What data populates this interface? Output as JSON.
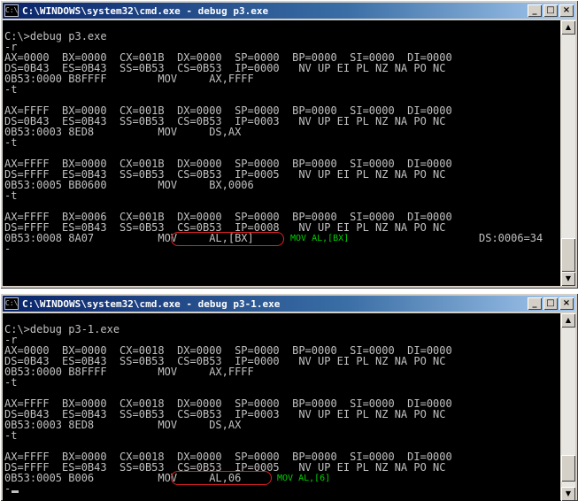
{
  "window1": {
    "title": "C:\\WINDOWS\\system32\\cmd.exe - debug p3.exe",
    "icon_text": "C:\\",
    "lines": [
      "",
      "C:\\>debug p3.exe",
      "-r",
      "AX=0000  BX=0000  CX=001B  DX=0000  SP=0000  BP=0000  SI=0000  DI=0000",
      "DS=0B43  ES=0B43  SS=0B53  CS=0B53  IP=0000   NV UP EI PL NZ NA PO NC",
      "0B53:0000 B8FFFF        MOV     AX,FFFF",
      "-t",
      "",
      "AX=FFFF  BX=0000  CX=001B  DX=0000  SP=0000  BP=0000  SI=0000  DI=0000",
      "DS=0B43  ES=0B43  SS=0B53  CS=0B53  IP=0003   NV UP EI PL NZ NA PO NC",
      "0B53:0003 8ED8          MOV     DS,AX",
      "-t",
      "",
      "AX=FFFF  BX=0000  CX=001B  DX=0000  SP=0000  BP=0000  SI=0000  DI=0000",
      "DS=FFFF  ES=0B43  SS=0B53  CS=0B53  IP=0005   NV UP EI PL NZ NA PO NC",
      "0B53:0005 BB0600        MOV     BX,0006",
      "-t",
      "",
      "AX=FFFF  BX=0006  CX=001B  DX=0000  SP=0000  BP=0000  SI=0000  DI=0000",
      "DS=FFFF  ES=0B43  SS=0B53  CS=0B53  IP=0008   NV UP EI PL NZ NA PO NC",
      "0B53:0008 8A07          MOV     AL,[BX]",
      "-"
    ],
    "ds_value": "DS:0006=34",
    "annotation": "MOV AL,[BX]"
  },
  "window2": {
    "title": "C:\\WINDOWS\\system32\\cmd.exe - debug p3-1.exe",
    "icon_text": "C:\\",
    "lines": [
      "",
      "C:\\>debug p3-1.exe",
      "-r",
      "AX=0000  BX=0000  CX=0018  DX=0000  SP=0000  BP=0000  SI=0000  DI=0000",
      "DS=0B43  ES=0B43  SS=0B53  CS=0B53  IP=0000   NV UP EI PL NZ NA PO NC",
      "0B53:0000 B8FFFF        MOV     AX,FFFF",
      "-t",
      "",
      "AX=FFFF  BX=0000  CX=0018  DX=0000  SP=0000  BP=0000  SI=0000  DI=0000",
      "DS=0B43  ES=0B43  SS=0B53  CS=0B53  IP=0003   NV UP EI PL NZ NA PO NC",
      "0B53:0003 8ED8          MOV     DS,AX",
      "-t",
      "",
      "AX=FFFF  BX=0000  CX=0018  DX=0000  SP=0000  BP=0000  SI=0000  DI=0000",
      "DS=FFFF  ES=0B43  SS=0B53  CS=0B53  IP=0005   NV UP EI PL NZ NA PO NC",
      "0B53:0005 B006          MOV     AL,06",
      "-"
    ],
    "annotation": "MOV AL,[6]"
  },
  "buttons": {
    "minimize": "_",
    "maximize": "□",
    "close": "×"
  },
  "scrollbar": {
    "up": "▲",
    "down": "▼"
  },
  "colors": {
    "console_bg": "#000000",
    "console_text": "#c0c0c0",
    "highlight": "#e02020",
    "annotation": "#00d000",
    "titlebar": "#0a246a"
  }
}
